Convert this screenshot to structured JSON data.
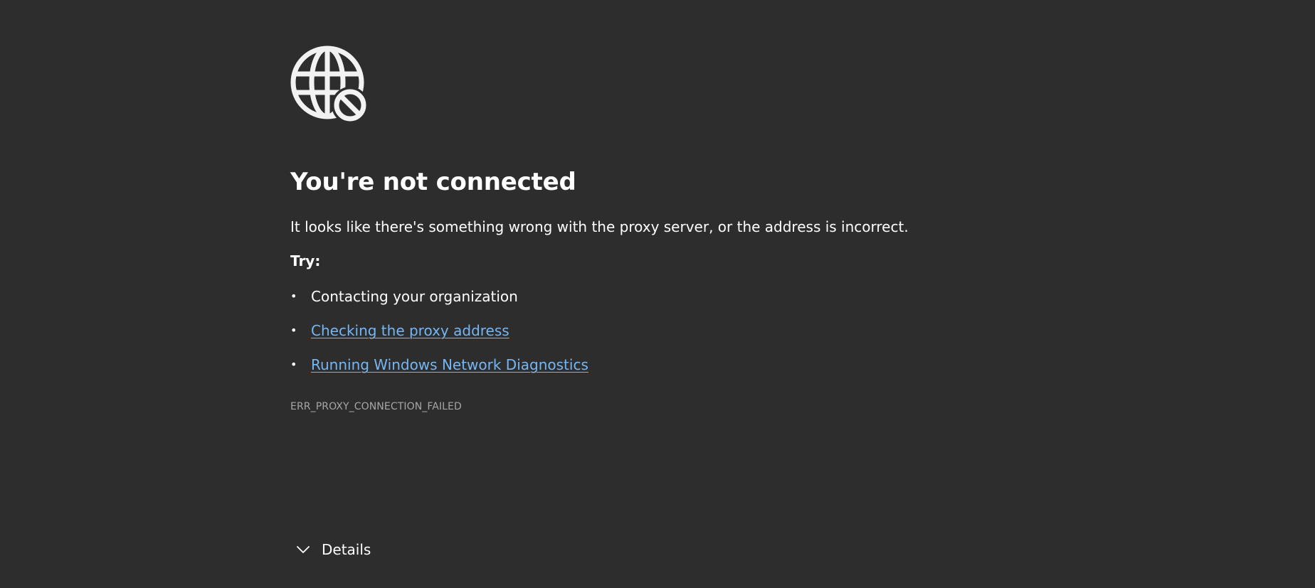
{
  "error_page": {
    "icon": "globe-blocked-icon",
    "title": "You're not connected",
    "description": "It looks like there's something wrong with the proxy server, or the address is incorrect.",
    "try_label": "Try:",
    "suggestions": [
      {
        "text": "Contacting your organization",
        "is_link": false
      },
      {
        "text": "Checking the proxy address",
        "is_link": true
      },
      {
        "text": "Running Windows Network Diagnostics",
        "is_link": true
      }
    ],
    "bullet": "•",
    "error_code": "ERR_PROXY_CONNECTION_FAILED",
    "details_label": "Details",
    "details_icon": "chevron-down-icon"
  },
  "colors": {
    "background": "#2d2d2d",
    "text": "#ffffff",
    "link": "#75b6f5",
    "muted": "#a6a6a6"
  }
}
